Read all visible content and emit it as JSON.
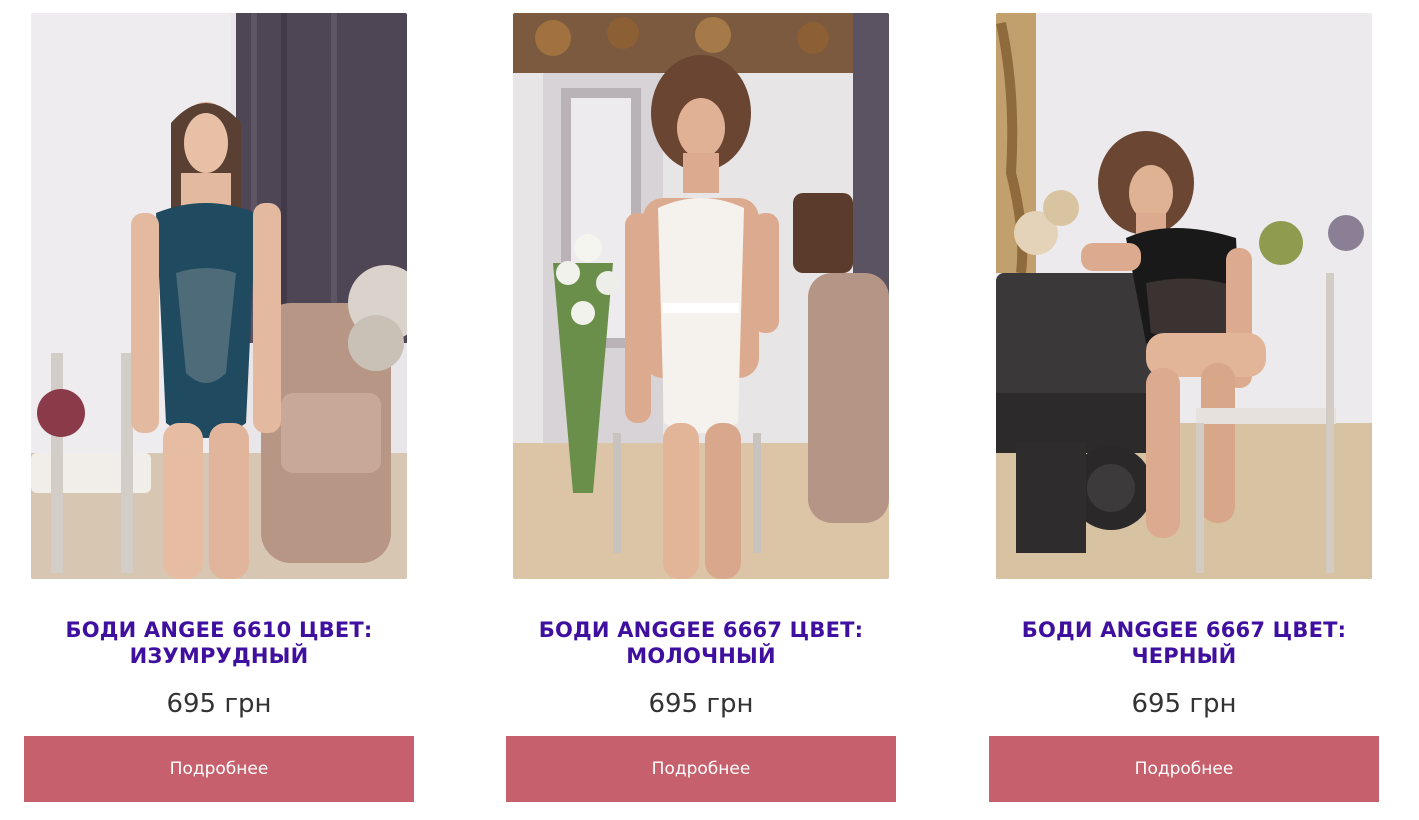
{
  "colors": {
    "title": "#3f0fa0",
    "price": "#333333",
    "button_bg": "#c6606d",
    "button_text": "#ffffff"
  },
  "products": [
    {
      "title": "БОДИ ANGEE 6610 ЦВЕТ:\nИЗУМРУДНЫЙ",
      "price": "695 грн",
      "button_label": "Подробнее",
      "image": "product-photo"
    },
    {
      "title": "БОДИ ANGGEE 6667 ЦВЕТ:\nМОЛОЧНЫЙ",
      "price": "695 грн",
      "button_label": "Подробнее",
      "image": "product-photo"
    },
    {
      "title": "БОДИ ANGGEE 6667 ЦВЕТ:\nЧЕРНЫЙ",
      "price": "695 грн",
      "button_label": "Подробнее",
      "image": "product-photo"
    }
  ]
}
